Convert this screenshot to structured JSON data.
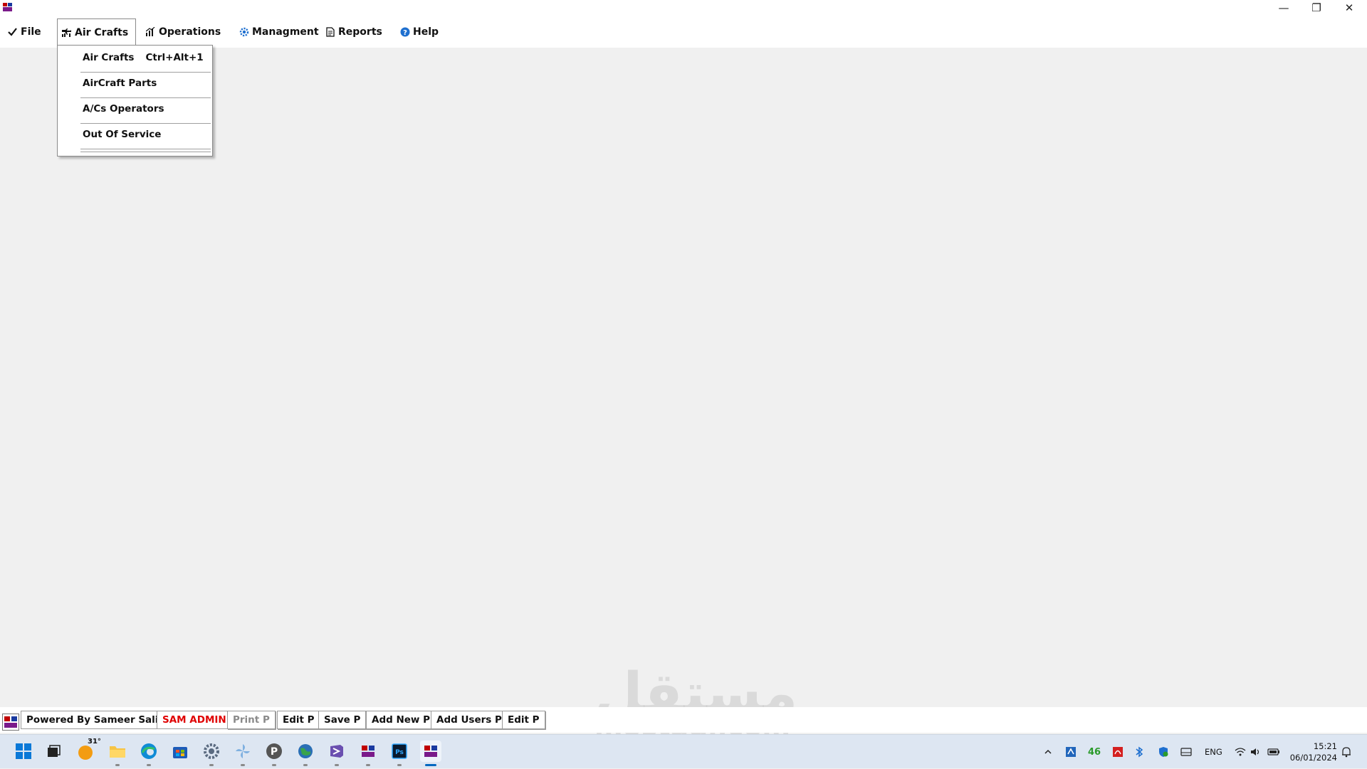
{
  "window": {
    "app_icon": "app-logo-icon",
    "controls": {
      "minimize": "—",
      "restore": "❐",
      "close": "✕"
    }
  },
  "menubar": {
    "items": [
      {
        "label": "File",
        "icon": "check-icon"
      },
      {
        "label": "Air Crafts",
        "icon": "aircraft-icon"
      },
      {
        "label": "Operations",
        "icon": "chart-icon"
      },
      {
        "label": "Managment",
        "icon": "gear-icon"
      },
      {
        "label": "Reports",
        "icon": "document-icon"
      },
      {
        "label": "Help",
        "icon": "help-icon"
      }
    ]
  },
  "dropdown": {
    "items": [
      {
        "label": "Air Crafts",
        "shortcut": "Ctrl+Alt+1"
      },
      {
        "label": "AirCraft Parts"
      },
      {
        "label": "A/Cs Operators"
      },
      {
        "label": "Out Of Service"
      }
    ]
  },
  "statusbar": {
    "powered_by": "Powered By Sameer Salih",
    "user": "SAM ADMIN",
    "perms": [
      "Print P",
      "Edit P",
      "Save P",
      "Add New P",
      "Add Users P",
      "Edit P"
    ]
  },
  "watermark": {
    "arabic": "مستقل",
    "latin": "mostaqi.com"
  },
  "taskbar": {
    "weather_temp": "31°",
    "tray": {
      "badge_count": "46",
      "language": "ENG"
    },
    "clock": {
      "time": "15:21",
      "date": "06/01/2024"
    }
  },
  "colors": {
    "accent": "#0067c0",
    "alert": "#e00000",
    "background": "#f0f0f0"
  }
}
